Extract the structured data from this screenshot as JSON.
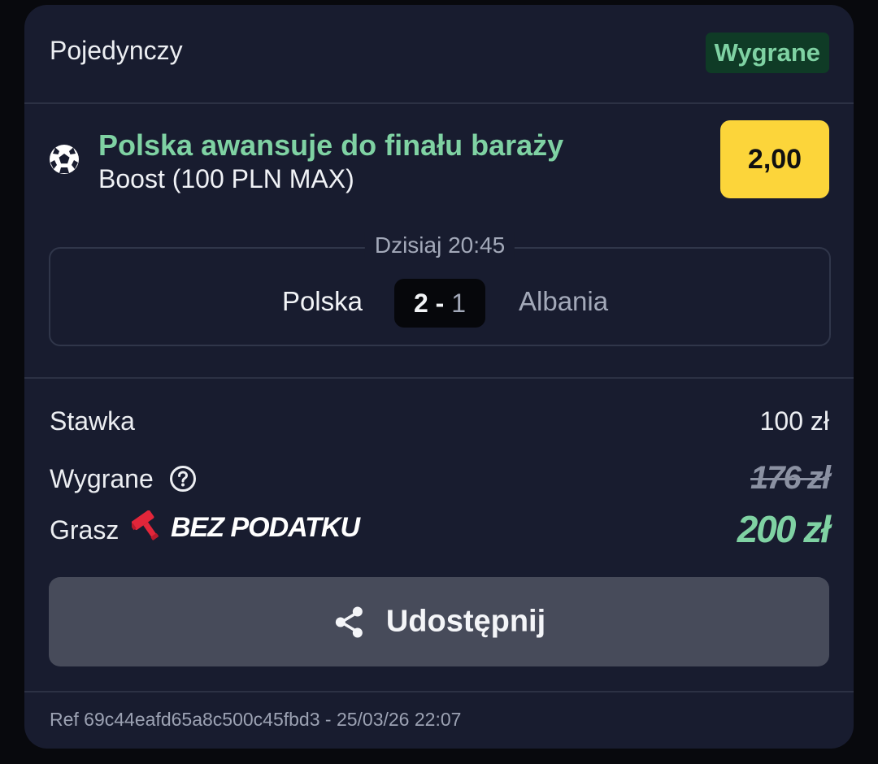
{
  "header": {
    "title": "Pojedynczy",
    "status": "Wygrane",
    "status_color": "#7fd2a3"
  },
  "selection": {
    "sport_icon": "soccer-ball-icon",
    "title": "Polska awansuje do finału baraży",
    "market": "Boost (100 PLN MAX)",
    "odds": "2,00"
  },
  "match": {
    "time": "Dzisiaj 20:45",
    "home_team": "Polska",
    "away_team": "Albania",
    "score_home": "2",
    "score_separator": "-",
    "score_away": "1"
  },
  "summary": {
    "stake_label": "Stawka",
    "stake_value": "100 zł",
    "winnings_label": "Wygrane",
    "winnings_help_icon": "question-circle-icon",
    "winnings_original": "176 zł",
    "tax_free_label": "Grasz",
    "tax_free_icon": "hammer-icon",
    "tax_free_brand": "BEZ PODATKU",
    "winnings_final": "200 zł"
  },
  "actions": {
    "share_label": "Udostępnij",
    "share_icon": "share-icon"
  },
  "footer": {
    "ref": "Ref 69c44eafd65a8c500c45fbd3 - 25/03/26 22:07"
  },
  "colors": {
    "card_background": "#181c2f",
    "accent_green": "#7fd2a3",
    "odds_yellow": "#fcd53a",
    "brand_red": "#e3263a"
  }
}
